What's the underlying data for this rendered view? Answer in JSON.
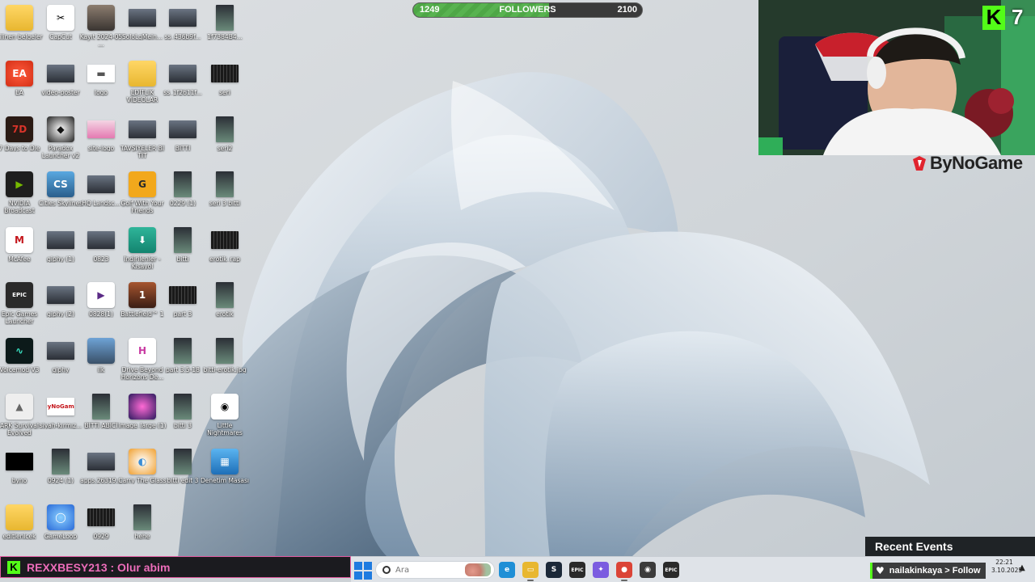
{
  "desktop": {
    "icons": [
      {
        "label": "silinen belgeler",
        "kind": "folder"
      },
      {
        "label": "CapCut",
        "kind": "capcut"
      },
      {
        "label": "Kayıt 2024-05 ...",
        "kind": "photo"
      },
      {
        "label": "SoloLqMein...",
        "kind": "thumb"
      },
      {
        "label": "ss_436b9f...",
        "kind": "thumb"
      },
      {
        "label": "1f7384B4...",
        "kind": "tall"
      },
      {
        "label": "EA",
        "kind": "ea"
      },
      {
        "label": "video-poster",
        "kind": "thumb"
      },
      {
        "label": "logo",
        "kind": "logo"
      },
      {
        "label": "EDİTLİK VİDEOLAR",
        "kind": "folder"
      },
      {
        "label": "ss_1f2611f...",
        "kind": "thumb"
      },
      {
        "label": "seri",
        "kind": "film"
      },
      {
        "label": "7 Days to Die",
        "kind": "7days"
      },
      {
        "label": "Paradox Launcher v2",
        "kind": "paradox"
      },
      {
        "label": "site-logo",
        "kind": "sitelogo"
      },
      {
        "label": "TAVSİYELER Bİ TİT",
        "kind": "thumb"
      },
      {
        "label": "BİTTİ",
        "kind": "thumb"
      },
      {
        "label": "seri2",
        "kind": "tall"
      },
      {
        "label": "NVIDIA Broadcast",
        "kind": "nvidia"
      },
      {
        "label": "Cities Skylines",
        "kind": "cities"
      },
      {
        "label": "HQ Landsc...",
        "kind": "thumb"
      },
      {
        "label": "Golf With Your Friends",
        "kind": "golf"
      },
      {
        "label": "0229 (1)",
        "kind": "tall"
      },
      {
        "label": "seri 3 bitti",
        "kind": "tall"
      },
      {
        "label": "McAfee",
        "kind": "mcafee"
      },
      {
        "label": "giphy (1)",
        "kind": "thumb"
      },
      {
        "label": "0823",
        "kind": "thumb"
      },
      {
        "label": "İndirilenler - Kısayol",
        "kind": "download"
      },
      {
        "label": "bitti",
        "kind": "tall"
      },
      {
        "label": "erotik_rap",
        "kind": "film"
      },
      {
        "label": "Epic Games Launcher",
        "kind": "epic"
      },
      {
        "label": "giphy (2)",
        "kind": "thumb"
      },
      {
        "label": "0828(1)",
        "kind": "play"
      },
      {
        "label": "Battlefield™ 1",
        "kind": "bf1"
      },
      {
        "label": "part 3",
        "kind": "film"
      },
      {
        "label": "erotik",
        "kind": "tall"
      },
      {
        "label": "Voicemod V3",
        "kind": "voicemod"
      },
      {
        "label": "giphy",
        "kind": "thumb"
      },
      {
        "label": "ilk",
        "kind": "pubg"
      },
      {
        "label": "Drive Beyond Horizons De...",
        "kind": "drive"
      },
      {
        "label": "part 3.5-18",
        "kind": "tall"
      },
      {
        "label": "bitti-erotik.jpg",
        "kind": "tall"
      },
      {
        "label": "ARK Survival Evolved",
        "kind": "ark"
      },
      {
        "label": "siyah-kırmız...",
        "kind": "bynogame"
      },
      {
        "label": "BİTTİ ABİCİ",
        "kind": "tall"
      },
      {
        "label": "image_large (1)",
        "kind": "image"
      },
      {
        "label": "bitti 3",
        "kind": "tall"
      },
      {
        "label": "Little Nightmares",
        "kind": "littlenight"
      },
      {
        "label": "byno",
        "kind": "black"
      },
      {
        "label": "0924 (1)",
        "kind": "tall"
      },
      {
        "label": "apps.26319...",
        "kind": "thumb"
      },
      {
        "label": "Carry The Glass",
        "kind": "carry"
      },
      {
        "label": "bitti edit 3",
        "kind": "tall"
      },
      {
        "label": "Denetim Masası",
        "kind": "control"
      },
      {
        "label": "editlenicek",
        "kind": "folder"
      },
      {
        "label": "GameLoop",
        "kind": "gameloop"
      },
      {
        "label": "0929",
        "kind": "film"
      },
      {
        "label": "hehe",
        "kind": "tall"
      }
    ]
  },
  "followers": {
    "current": "1249",
    "label": "FOLLOWERS",
    "goal": "2100",
    "progress": 0.595
  },
  "webcam": {
    "brand": "ByNoGame",
    "kick_letter": "K",
    "viewer_count": "7"
  },
  "chat": {
    "kick_letter": "K",
    "message": "REXXBESY213 : Olur abim"
  },
  "taskbar": {
    "search_placeholder": "Ara",
    "apps": [
      {
        "name": "edge-icon",
        "glyph": "e",
        "color": "#1f8fd6"
      },
      {
        "name": "file-explorer-icon",
        "glyph": "▭",
        "color": "#e8b730"
      },
      {
        "name": "steam-icon",
        "glyph": "S",
        "color": "#1b2838"
      },
      {
        "name": "epic-games-icon",
        "glyph": "EPIC",
        "color": "#2a2a2a"
      },
      {
        "name": "copilot-icon",
        "glyph": "✦",
        "color": "#7b5ce0"
      },
      {
        "name": "chrome-icon",
        "glyph": "●",
        "color": "#db4437"
      },
      {
        "name": "obs-icon",
        "glyph": "◉",
        "color": "#3b3b3b"
      },
      {
        "name": "epic-games-2-icon",
        "glyph": "EPIC",
        "color": "#2a2a2a"
      }
    ],
    "clock_time": "22:21",
    "clock_date": "3.10.2025"
  },
  "events": {
    "title": "Recent Events",
    "latest": "nailakinkaya > Follow"
  }
}
